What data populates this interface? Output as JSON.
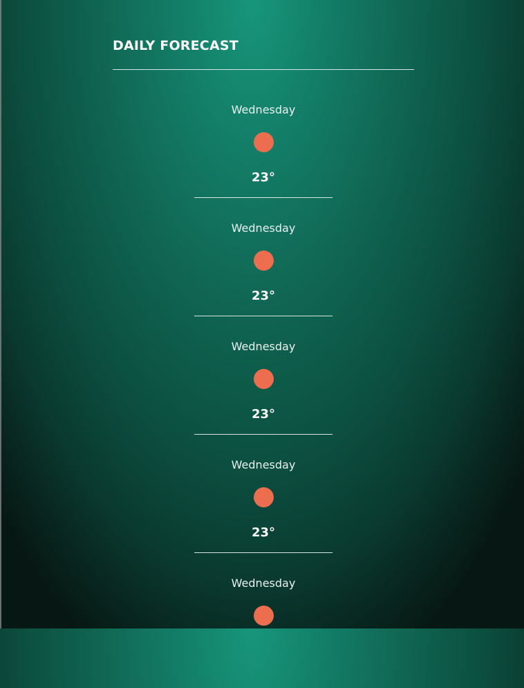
{
  "header": {
    "title": "DAILY FORECAST"
  },
  "icon": {
    "name": "sun-icon",
    "color": "#ec6e4f"
  },
  "forecast": [
    {
      "day": "Wednesday",
      "temp": "23°"
    },
    {
      "day": "Wednesday",
      "temp": "23°"
    },
    {
      "day": "Wednesday",
      "temp": "23°"
    },
    {
      "day": "Wednesday",
      "temp": "23°"
    },
    {
      "day": "Wednesday"
    }
  ]
}
